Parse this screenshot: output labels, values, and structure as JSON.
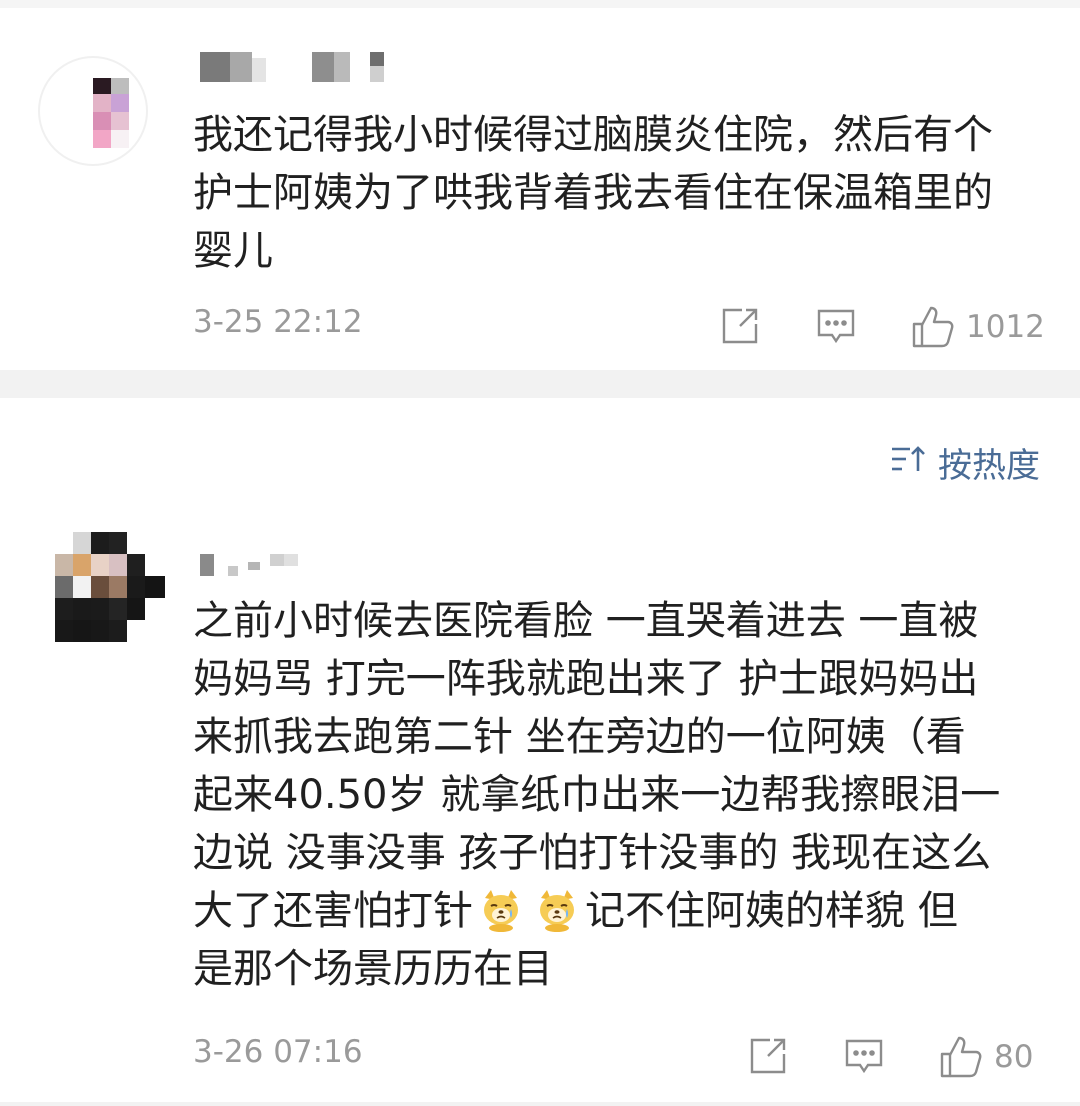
{
  "comments": [
    {
      "text": "我还记得我小时候得过脑膜炎住院，然后有个\n护士阿姨为了哄我背着我去看住在保温箱里的\n婴儿",
      "time": "3-25 22:12",
      "likes": "1012"
    },
    {
      "text_segments": [
        "之前小时候去医院看脸 一直哭着进去 一直被\n妈妈骂 打完一阵我就跑出来了 护士跟妈妈出\n来抓我去跑第二针 坐在旁边的一位阿姨（看\n起来40.50岁 就拿纸巾出来一边帮我擦眼泪一\n边说 没事没事 孩子怕打针没事的 我现在这么\n大了还害怕打针",
        "记不住阿姨的样貌 但\n是那个场景历历在目"
      ],
      "emojis": [
        "crying-dog-emoji",
        "crying-dog-emoji"
      ],
      "time": "3-26 07:16",
      "likes": "80"
    }
  ],
  "sort": {
    "label": "按热度",
    "icon": "sort-icon",
    "color": "#4a6c96"
  },
  "icons": {
    "share": "share-icon",
    "comment": "comment-icon",
    "like": "thumbs-up-icon"
  }
}
